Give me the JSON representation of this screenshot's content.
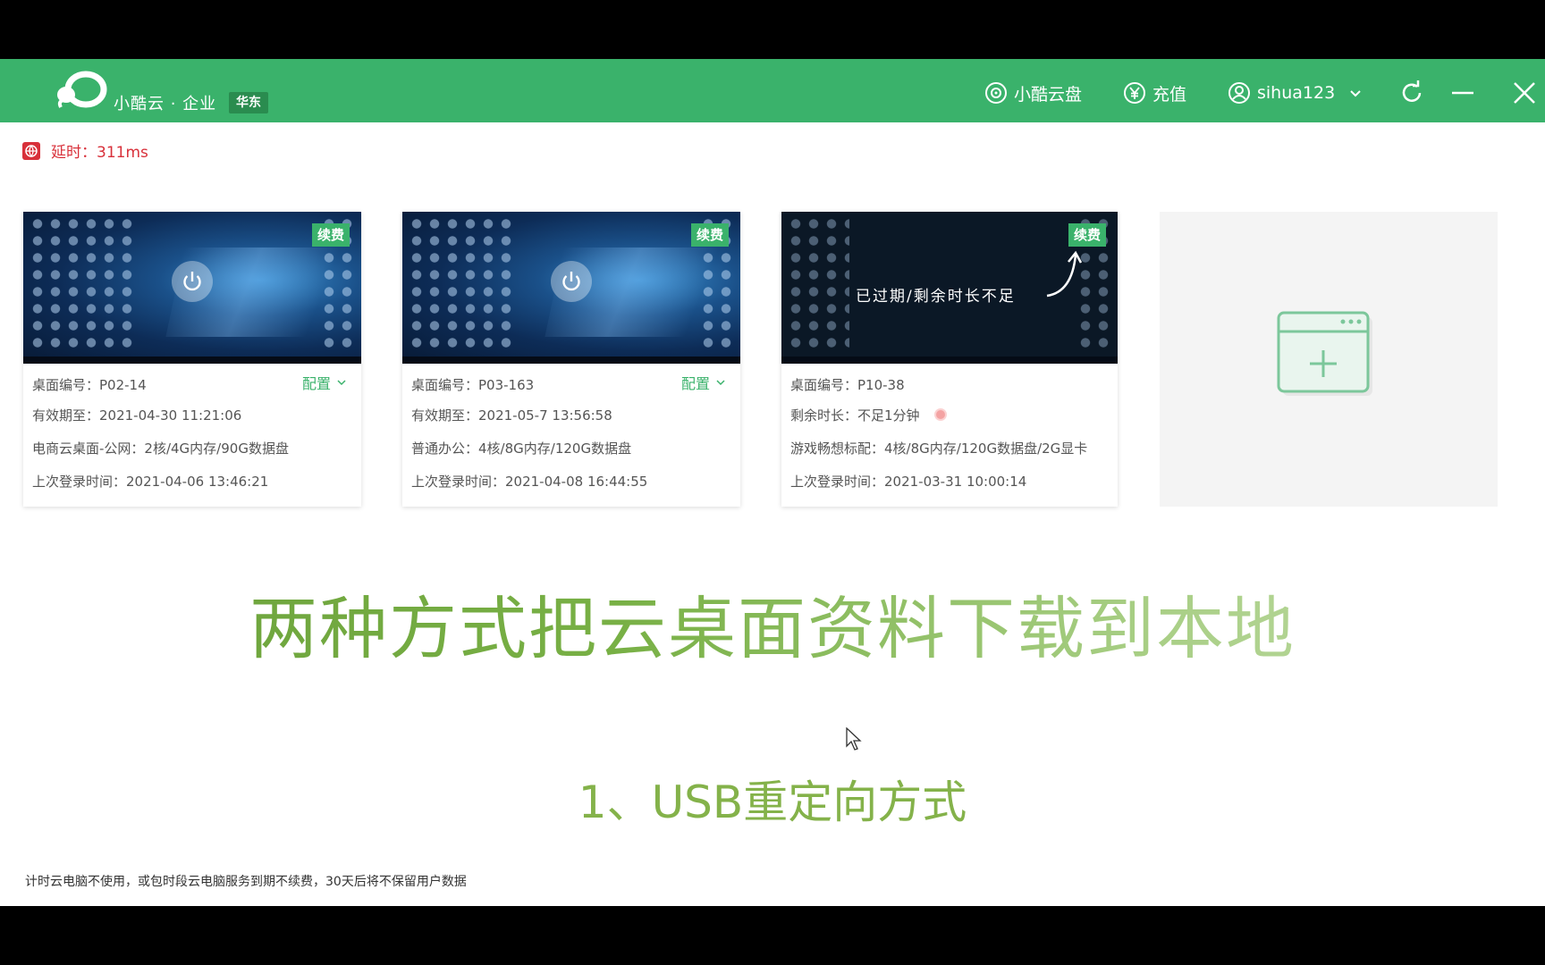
{
  "header": {
    "brand": "小酷云 · 企业",
    "region": "华东",
    "cloud_disk": "小酷云盘",
    "recharge": "充值",
    "username": "sihua123",
    "icons": [
      "cloud-disk-icon",
      "yuan-icon",
      "user-icon",
      "chevron-down-icon",
      "refresh-icon",
      "minimize-icon",
      "close-icon"
    ]
  },
  "latency": {
    "label": "延时：311ms"
  },
  "cards": [
    {
      "renew": "续费",
      "id": "桌面编号：P02-14",
      "config": "配置",
      "line2": "有效期至：2021-04-30 11:21:06",
      "spec": "电商云桌面-公网：2核/4G内存/90G数据盘",
      "last_login": "上次登录时间：2021-04-06 13:46:21"
    },
    {
      "renew": "续费",
      "id": "桌面编号：P03-163",
      "config": "配置",
      "line2": "有效期至：2021-05-7 13:56:58",
      "spec": "普通办公：4核/8G内存/120G数据盘",
      "last_login": "上次登录时间：2021-04-08 16:44:55"
    },
    {
      "renew": "续费",
      "overlay": "已过期/剩余时长不足",
      "id": "桌面编号：P10-38",
      "line2": "剩余时长：不足1分钟",
      "spec": "游戏畅想标配：4核/8G内存/120G数据盘/2G显卡",
      "last_login": "上次登录时间：2021-03-31 10:00:14"
    }
  ],
  "headline": "两种方式把云桌面资料下载到本地",
  "subhead": "1、USB重定向方式",
  "footnote": "计时云电脑不使用，或包时段云电脑服务到期不续费，30天后将不保留用户数据",
  "colors": {
    "brand_green": "#3ab26b",
    "latency_red": "#d8303a",
    "headline_green": "#6aa03a"
  }
}
